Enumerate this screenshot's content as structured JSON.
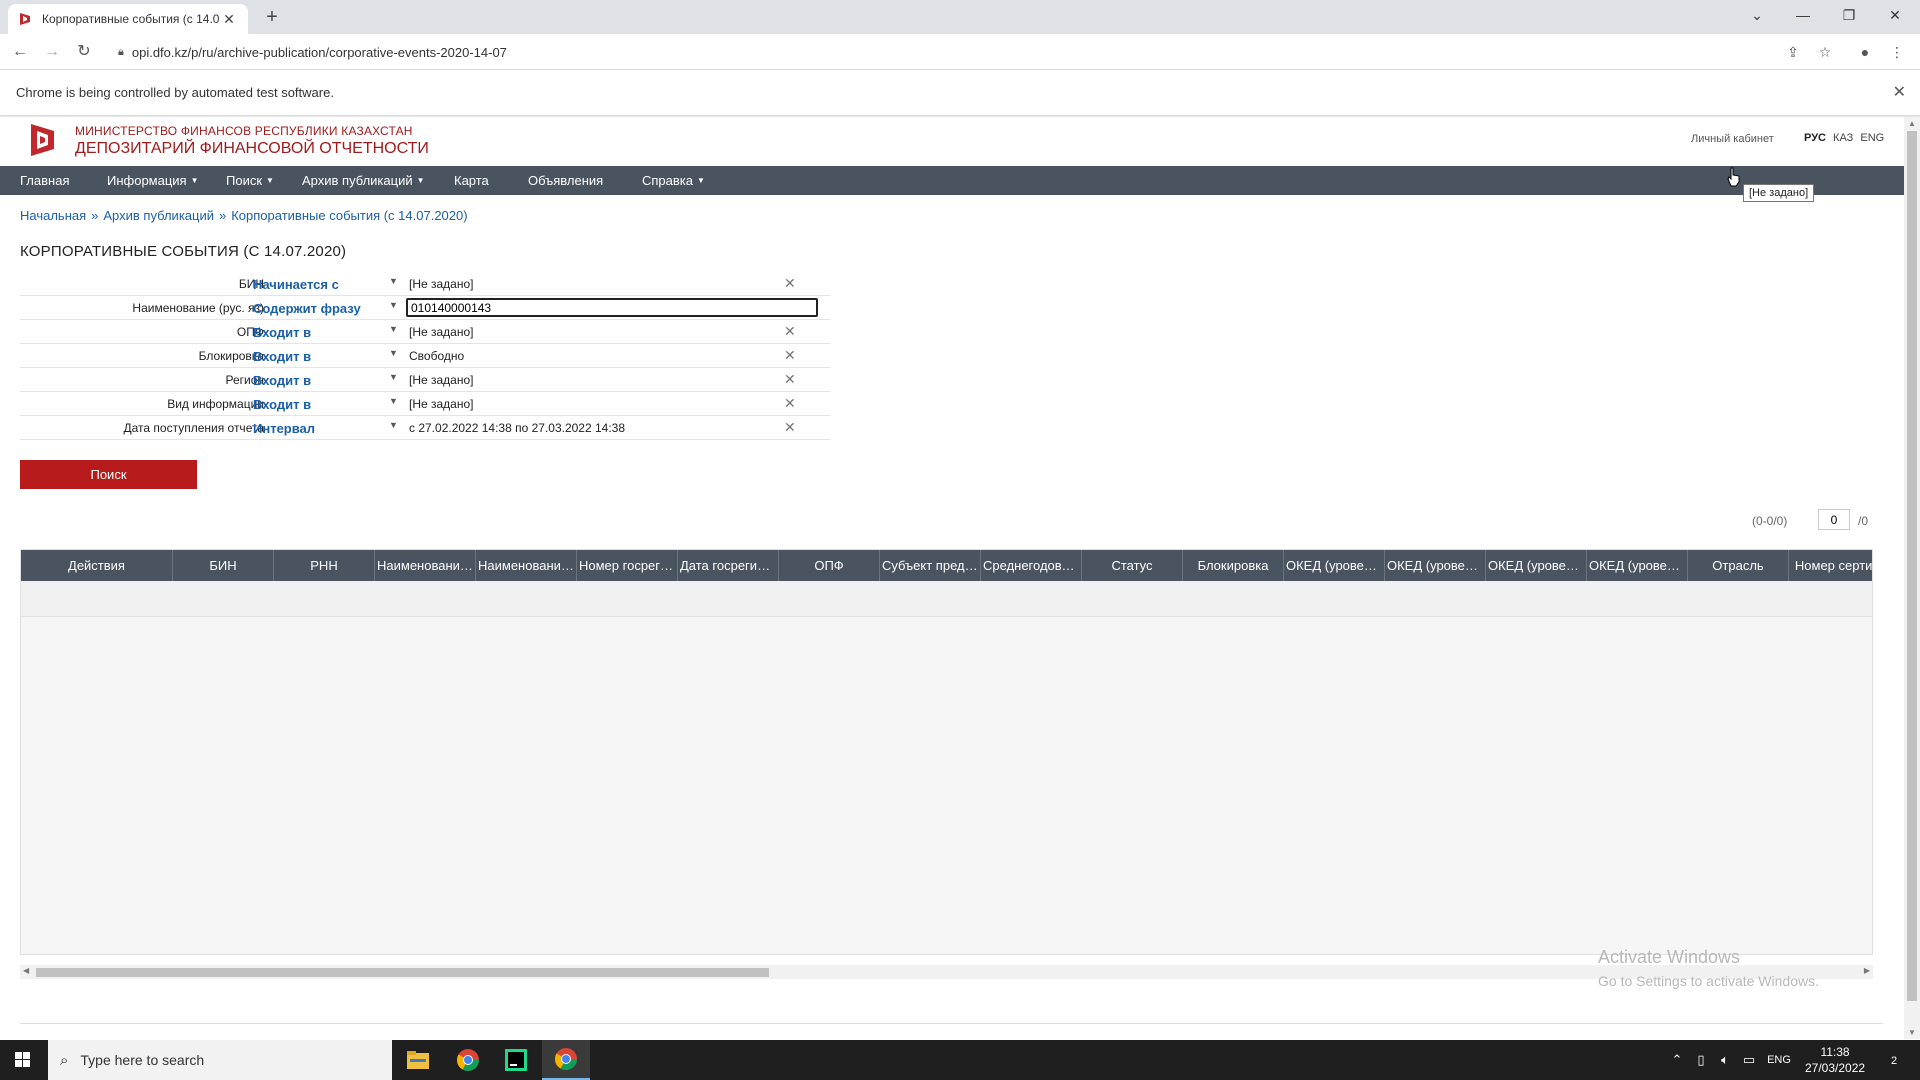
{
  "browser": {
    "tab_title": "Корпоративные события (с 14.0",
    "url": "opi.dfo.kz/p/ru/archive-publication/corporative-events-2020-14-07",
    "infobar_text": "Chrome is being controlled by automated test software."
  },
  "header": {
    "org_line1": "МИНИСТЕРСТВО ФИНАНСОВ РЕСПУБЛИКИ КАЗАХСТАН",
    "org_line2": "ДЕПОЗИТАРИЙ ФИНАНСОВОЙ ОТЧЕТНОСТИ",
    "cabinet": "Личный кабинет",
    "langs": [
      "РУС",
      "КАЗ",
      "ENG"
    ]
  },
  "nav": [
    "Главная",
    "Информация",
    "Поиск",
    "Архив публикаций",
    "Карта",
    "Объявления",
    "Справка"
  ],
  "tooltip": "[Не задано]",
  "breadcrumb": [
    "Начальная",
    "Архив публикаций",
    "Корпоративные события (с 14.07.2020)"
  ],
  "breadcrumb_sep": "»",
  "page_title": "КОРПОРАТИВНЫЕ СОБЫТИЯ (С 14.07.2020)",
  "filters": [
    {
      "label": "БИН",
      "op": "Начинается с",
      "value": "[Не задано]"
    },
    {
      "label": "Наименование (рус. яз)",
      "op": "Содержит фразу",
      "value": "010140000143"
    },
    {
      "label": "ОПФ",
      "op": "Входит в",
      "value": "[Не задано]"
    },
    {
      "label": "Блокировка",
      "op": "Входит в",
      "value": "Свободно"
    },
    {
      "label": "Регион",
      "op": "Входит в",
      "value": "[Не задано]"
    },
    {
      "label": "Вид информации",
      "op": "Входит в",
      "value": "[Не задано]"
    },
    {
      "label": "Дата поступления отчета",
      "op": "Интервал",
      "value": "с 27.02.2022 14:38 по 27.03.2022 14:38"
    }
  ],
  "search_button": "Поиск",
  "pager": {
    "range": "(0-0/0)",
    "page": "0",
    "total": "/0"
  },
  "columns": [
    "Действия",
    "БИН",
    "РНН",
    "Наименование...",
    "Наименование...",
    "Номер госреги...",
    "Дата госрегист...",
    "ОПФ",
    "Субъект предп...",
    "Среднегодова...",
    "Статус",
    "Блокировка",
    "ОКЕД (уровень...",
    "ОКЕД (уровень...",
    "ОКЕД (уровень...",
    "ОКЕД (уровень...",
    "Отрасль",
    "Номер сертиф"
  ],
  "watermark": {
    "line1": "Activate Windows",
    "line2": "Go to Settings to activate Windows."
  },
  "taskbar": {
    "search_placeholder": "Type here to search",
    "lang": "ENG",
    "time": "11:38",
    "date": "27/03/2022",
    "notifications": "2"
  }
}
